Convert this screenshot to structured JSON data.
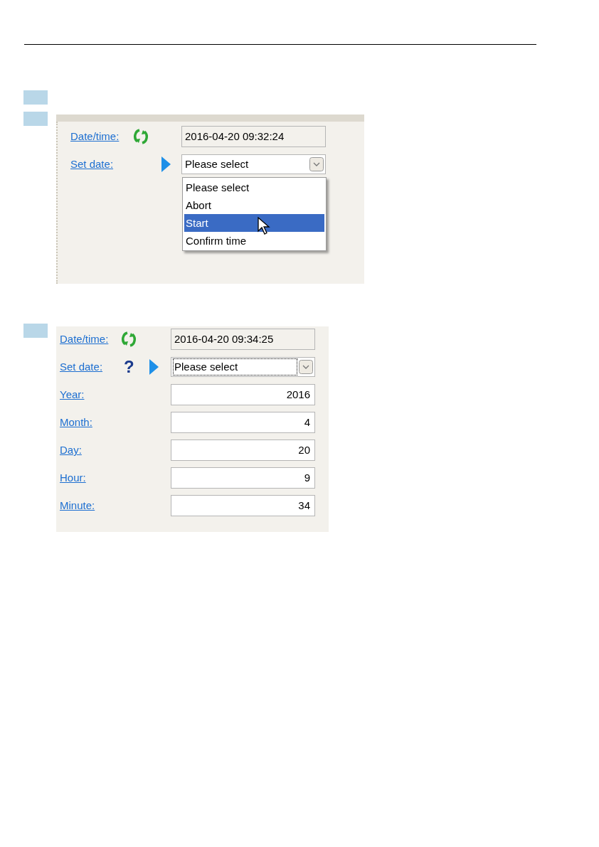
{
  "panel_1": {
    "date_time": {
      "label": "Date/time:",
      "value": "2016-04-20 09:32:24"
    },
    "set_date": {
      "label": "Set date:",
      "value": "Please select",
      "focused": false
    },
    "dropdown": {
      "options": [
        {
          "label": "Please select",
          "selected": false
        },
        {
          "label": "Abort",
          "selected": false
        },
        {
          "label": "Start",
          "selected": true
        },
        {
          "label": "Confirm time",
          "selected": false
        }
      ]
    }
  },
  "panel_2": {
    "date_time": {
      "label": "Date/time:",
      "value": "2016-04-20 09:34:25"
    },
    "set_date": {
      "label": "Set date:",
      "help": "?",
      "value": "Please select",
      "focused": true
    },
    "fields": [
      {
        "label": "Year:",
        "value": "2016"
      },
      {
        "label": "Month:",
        "value": "4"
      },
      {
        "label": "Day:",
        "value": "20"
      },
      {
        "label": "Hour:",
        "value": "9"
      },
      {
        "label": "Minute:",
        "value": "34"
      }
    ]
  }
}
